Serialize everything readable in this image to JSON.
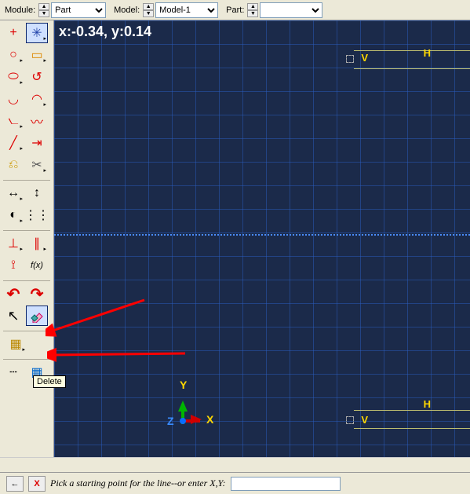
{
  "topbar": {
    "module_label": "Module:",
    "module_value": "Part",
    "model_label": "Model:",
    "model_value": "Model-1",
    "part_label": "Part:",
    "part_value": ""
  },
  "viewport": {
    "coord_readout": "x:-0.34, y:0.14",
    "axis_y": "Y",
    "axis_x": "X",
    "axis_z": "Z",
    "dim_h_upper": "H",
    "dim_h_lower": "H",
    "dim_v_upper": "V",
    "dim_v_lower": "V"
  },
  "tooltip": {
    "delete": "Delete"
  },
  "prompt": {
    "back_glyph": "←",
    "cancel_glyph": "X",
    "text": "Pick a starting point for the line--or enter X,Y:",
    "input_value": ""
  },
  "toolbox": {
    "create_point": "+",
    "connected_lines": "✳",
    "circle_center": "○",
    "rectangle": "▭",
    "ellipse_center": "⬭",
    "arc_tangent": "↺",
    "arc_center": "◡",
    "arc_3pt": "◠",
    "spline": "〰",
    "fillet": "⦦",
    "construction_line": "╱",
    "offset": "⇥",
    "project_edges": "⎌",
    "trim_extend": "✂",
    "dim_horizontal": "↔",
    "dim_vertical": "↕",
    "dim_radial": "◐",
    "linear_pattern": "⋮⋮",
    "constraint_perp": "⊥",
    "constraint_parallel": "∥",
    "add_dim": "⟟",
    "parameter": "f(x)",
    "undo": "↶",
    "redo": "↷",
    "select": "↖",
    "delete": "◧",
    "save_sketch": "▦",
    "options1": "┄",
    "options2": "▦"
  }
}
